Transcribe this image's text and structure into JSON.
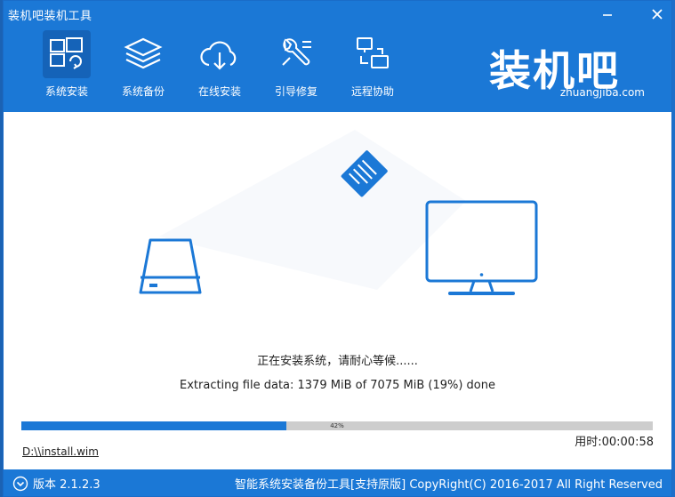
{
  "window": {
    "title": "装机吧装机工具",
    "minimize_icon": "minimize-icon",
    "close_icon": "close-icon"
  },
  "nav": {
    "items": [
      {
        "label": "系统安装",
        "icon": "windows-install-icon",
        "active": true
      },
      {
        "label": "系统备份",
        "icon": "layers-backup-icon",
        "active": false
      },
      {
        "label": "在线安装",
        "icon": "cloud-download-icon",
        "active": false
      },
      {
        "label": "引导修复",
        "icon": "wrench-repair-icon",
        "active": false
      },
      {
        "label": "远程协助",
        "icon": "remote-assist-icon",
        "active": false
      }
    ]
  },
  "logo": {
    "cn": "装机吧",
    "en": "zhuangjiba.com"
  },
  "install": {
    "status": "正在安装系统，请耐心等候......",
    "detail": "Extracting file data: 1379 MiB of 7075 MiB (19%) done",
    "progress_percent": 42,
    "progress_label": "42%",
    "elapsed": "用时:00:00:58",
    "file_path": "D:\\\\install.wim"
  },
  "footer": {
    "version": "版本 2.1.2.3",
    "copyright": "智能系统安装备份工具[支持原版]   CopyRight(C) 2016-2017 All Right Reserved"
  },
  "colors": {
    "primary": "#1b78d6",
    "active_nav": "#1563b8",
    "progress_track": "#cdcdcd"
  }
}
